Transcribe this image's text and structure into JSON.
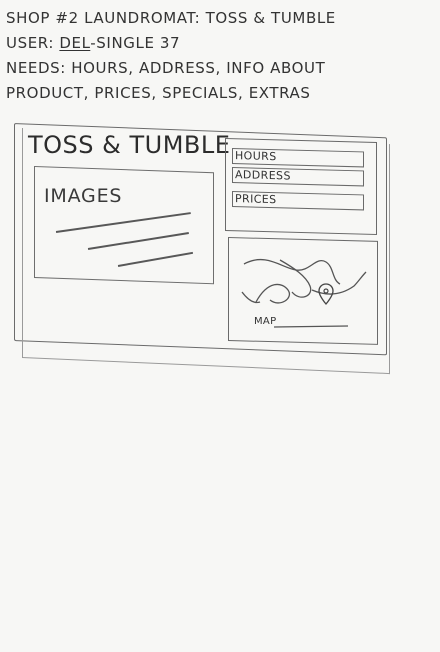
{
  "notes": {
    "line1": "Shop #2 Laundromat: Toss & Tumble",
    "line2_prefix": "User: ",
    "line2_user": "Del",
    "line2_suffix": "-Single 37",
    "line3": "Needs: Hours, Address, Info About",
    "line4": "Product, Prices, Specials, Extras"
  },
  "sketch": {
    "title": "Toss & Tumble",
    "images_label": "Images",
    "nav": {
      "hours": "Hours",
      "address": "Address",
      "prices": "Prices"
    },
    "map_label": "Map"
  }
}
